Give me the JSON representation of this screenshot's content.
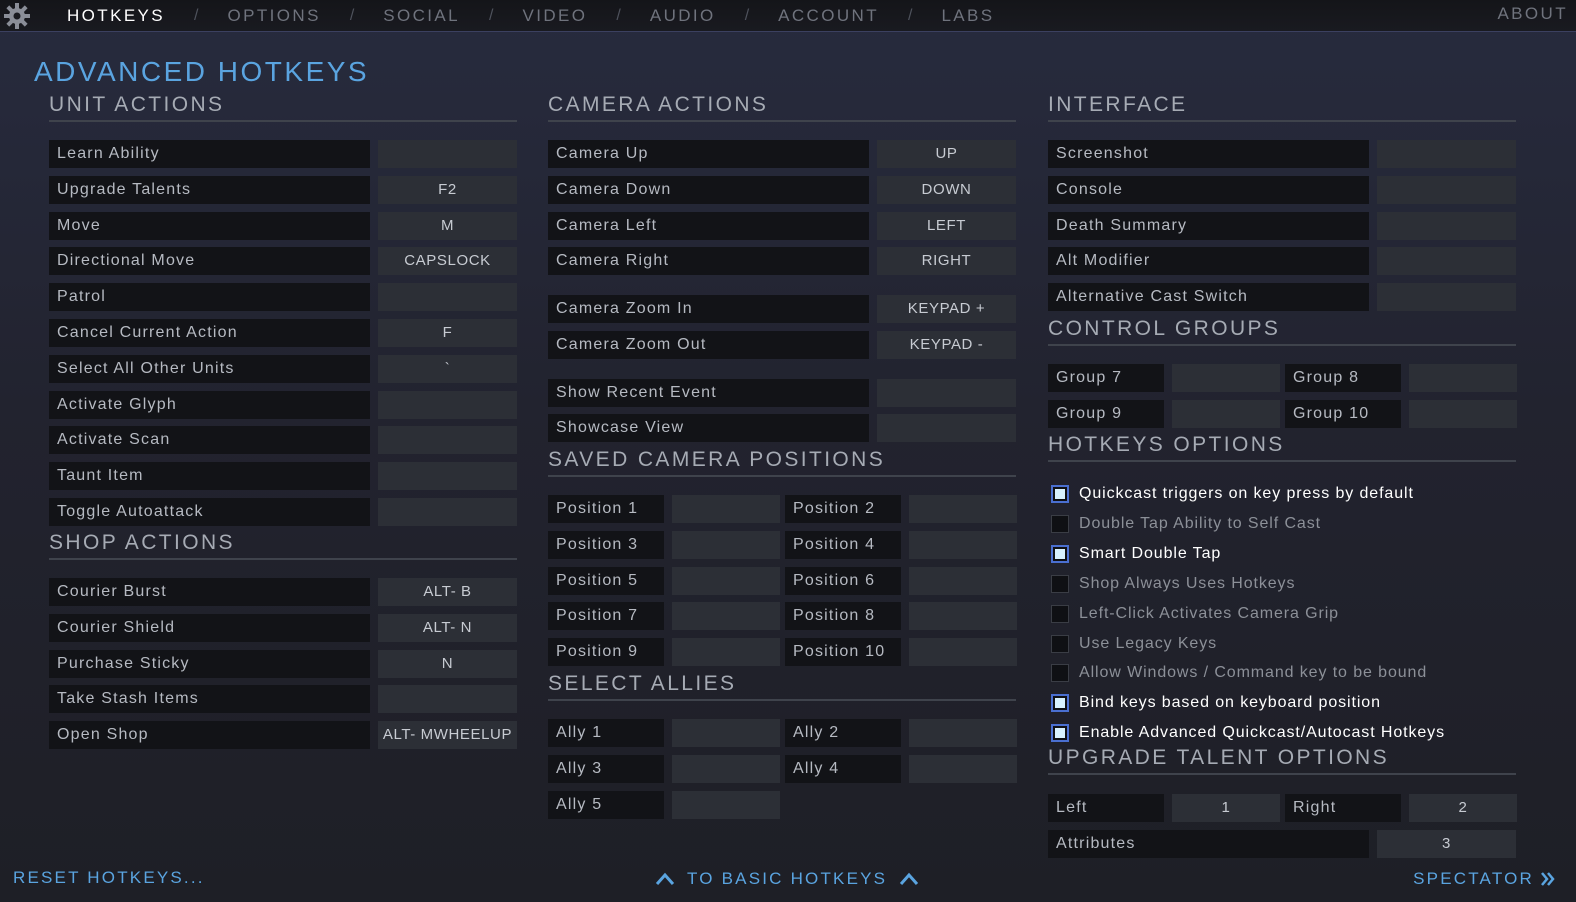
{
  "nav": {
    "items": [
      "HOTKEYS",
      "OPTIONS",
      "SOCIAL",
      "VIDEO",
      "AUDIO",
      "ACCOUNT",
      "LABS"
    ],
    "separator": "/",
    "about": "ABOUT"
  },
  "page_title": "ADVANCED HOTKEYS",
  "unit_actions": {
    "title": "UNIT ACTIONS",
    "rows": [
      {
        "label": "Learn Ability",
        "key": ""
      },
      {
        "label": "Upgrade Talents",
        "key": "F2"
      },
      {
        "label": "Move",
        "key": "M"
      },
      {
        "label": "Directional Move",
        "key": "CAPSLOCK"
      },
      {
        "label": "Patrol",
        "key": ""
      },
      {
        "label": "Cancel Current Action",
        "key": "F"
      },
      {
        "label": "Select All Other Units",
        "key": "`"
      },
      {
        "label": "Activate Glyph",
        "key": ""
      },
      {
        "label": "Activate Scan",
        "key": ""
      },
      {
        "label": "Taunt Item",
        "key": ""
      },
      {
        "label": "Toggle Autoattack",
        "key": ""
      }
    ]
  },
  "shop_actions": {
    "title": "SHOP ACTIONS",
    "rows": [
      {
        "label": "Courier Burst",
        "key": "ALT- B"
      },
      {
        "label": "Courier Shield",
        "key": "ALT- N"
      },
      {
        "label": "Purchase Sticky",
        "key": "N"
      },
      {
        "label": "Take Stash Items",
        "key": ""
      },
      {
        "label": "Open Shop",
        "key": "ALT- MWHEELUP"
      }
    ]
  },
  "camera_actions": {
    "title": "CAMERA ACTIONS",
    "rows": [
      {
        "label": "Camera Up",
        "key": "UP"
      },
      {
        "label": "Camera Down",
        "key": "DOWN"
      },
      {
        "label": "Camera Left",
        "key": "LEFT"
      },
      {
        "label": "Camera Right",
        "key": "RIGHT"
      },
      {
        "label": "Camera Zoom In",
        "key": "KEYPAD +"
      },
      {
        "label": "Camera Zoom Out",
        "key": "KEYPAD -"
      },
      {
        "label": "Show Recent Event",
        "key": ""
      },
      {
        "label": "Showcase View",
        "key": ""
      }
    ]
  },
  "saved_camera": {
    "title": "SAVED CAMERA POSITIONS",
    "items": [
      {
        "label": "Position 1",
        "key": ""
      },
      {
        "label": "Position 2",
        "key": ""
      },
      {
        "label": "Position 3",
        "key": ""
      },
      {
        "label": "Position 4",
        "key": ""
      },
      {
        "label": "Position 5",
        "key": ""
      },
      {
        "label": "Position 6",
        "key": ""
      },
      {
        "label": "Position 7",
        "key": ""
      },
      {
        "label": "Position 8",
        "key": ""
      },
      {
        "label": "Position 9",
        "key": ""
      },
      {
        "label": "Position 10",
        "key": ""
      }
    ]
  },
  "select_allies": {
    "title": "SELECT ALLIES",
    "items": [
      {
        "label": "Ally 1",
        "key": ""
      },
      {
        "label": "Ally 2",
        "key": ""
      },
      {
        "label": "Ally 3",
        "key": ""
      },
      {
        "label": "Ally 4",
        "key": ""
      },
      {
        "label": "Ally 5",
        "key": ""
      }
    ]
  },
  "interface": {
    "title": "INTERFACE",
    "rows": [
      {
        "label": "Screenshot",
        "key": ""
      },
      {
        "label": "Console",
        "key": ""
      },
      {
        "label": "Death Summary",
        "key": ""
      },
      {
        "label": "Alt Modifier",
        "key": ""
      },
      {
        "label": "Alternative Cast Switch",
        "key": ""
      }
    ]
  },
  "control_groups": {
    "title": "CONTROL GROUPS",
    "items": [
      {
        "label": "Group 7",
        "key": ""
      },
      {
        "label": "Group 8",
        "key": ""
      },
      {
        "label": "Group 9",
        "key": ""
      },
      {
        "label": "Group 10",
        "key": ""
      }
    ]
  },
  "hotkeys_options": {
    "title": "HOTKEYS OPTIONS",
    "options": [
      {
        "label": "Quickcast triggers on key press by default",
        "checked": true
      },
      {
        "label": "Double Tap Ability to Self Cast",
        "checked": false
      },
      {
        "label": "Smart Double Tap",
        "checked": true
      },
      {
        "label": "Shop Always Uses Hotkeys",
        "checked": false
      },
      {
        "label": "Left-Click Activates Camera Grip",
        "checked": false
      },
      {
        "label": "Use Legacy Keys",
        "checked": false
      },
      {
        "label": "Allow Windows / Command key to be bound",
        "checked": false
      },
      {
        "label": "Bind keys based on keyboard position",
        "checked": true
      },
      {
        "label": "Enable Advanced Quickcast/Autocast Hotkeys",
        "checked": true
      }
    ]
  },
  "upgrade_talent": {
    "title": "UPGRADE TALENT OPTIONS",
    "left_label": "Left",
    "left_key": "1",
    "right_label": "Right",
    "right_key": "2",
    "attributes_label": "Attributes",
    "attributes_key": "3"
  },
  "footer": {
    "reset": "RESET HOTKEYS...",
    "basic": "TO BASIC HOTKEYS",
    "spectator": "SPECTATOR"
  },
  "colors": {
    "accent_blue": "#5aa4e0",
    "label_bg": "#121317",
    "key_bg": "#2c2f36",
    "checkbox_border": "#4a6fd0"
  }
}
